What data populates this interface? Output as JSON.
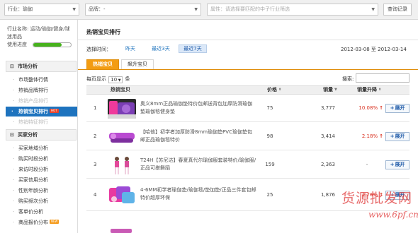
{
  "filters": {
    "industry": "行业：瑜伽",
    "brand": "品牌：-",
    "attribute_placeholder": "属性：请选择要匹配的中子行业筛选",
    "query_history": "查询记录"
  },
  "sidebar": {
    "industry_info": "行业名称: 运动/瑜伽/健身/球迷用品",
    "usage_label": "使用进度",
    "usage_progress": 0.75,
    "market_group": "市场分析",
    "market_items": [
      "市场整体行情",
      "热销品牌排行",
      "热销产品排行",
      "热销宝贝排行",
      "热销特征排行"
    ],
    "buyer_group": "买家分析",
    "buyer_items": [
      "买家地域分析",
      "购买时段分析",
      "来访时段分析",
      "买家信用分析",
      "性别年龄分析",
      "购买频次分析",
      "客单价分析",
      "商品报价分布"
    ],
    "hot_badge": "HOT",
    "new_badge": "NEW"
  },
  "main": {
    "title": "热销宝贝排行",
    "time_label": "选择时间：",
    "ranges": [
      "昨天",
      "最近3天",
      "最近7天"
    ],
    "date_from": "2012-03-08",
    "date_sep": "至",
    "date_to": "2012-03-14",
    "tabs": [
      "热销宝贝",
      "飙升宝贝"
    ],
    "per_page_prefix": "每页显示",
    "per_page_value": "10",
    "per_page_suffix": "条",
    "search_label": "搜索:",
    "columns": {
      "product": "热销宝贝",
      "price": "价格",
      "sales": "销量",
      "rise": "销量升降"
    },
    "expand_label": "展开",
    "rows": [
      {
        "idx": "1",
        "name": "奥义8mm正品瑜伽垫特价包邮送背包加厚防滑瑜伽垫瑜伽毯健身垫",
        "price": "75",
        "sales": "3,777",
        "rise": "10.08%",
        "trend": "up"
      },
      {
        "idx": "2",
        "name": "【哈他】初学者加厚防滑8mm瑜伽垫PVC瑜伽垫包邮正品瑜伽毯特价",
        "price": "98",
        "sales": "3,414",
        "rise": "2.18%",
        "trend": "up"
      },
      {
        "idx": "3",
        "name": "T24H【苏尼达】春夏真代尔瑜伽服套装特价/瑜伽服/正品可搭舞蹈",
        "price": "159",
        "sales": "2,363",
        "rise": "-",
        "trend": "none"
      },
      {
        "idx": "4",
        "name": "4-6MM初学者瑜伽垫/瑜伽毯/垫加垫/正品三件套包邮特价超厚环保",
        "price": "25",
        "sales": "1,876",
        "rise": "1.76%",
        "trend": "up"
      }
    ]
  },
  "watermark": {
    "cn": "货源批发网",
    "url": "www.6pf.cn"
  },
  "colors": {
    "nav_active": "#1e73be",
    "tab_active": "#f39c12",
    "rise_up": "#d9301f",
    "progress": "#46b21c"
  }
}
